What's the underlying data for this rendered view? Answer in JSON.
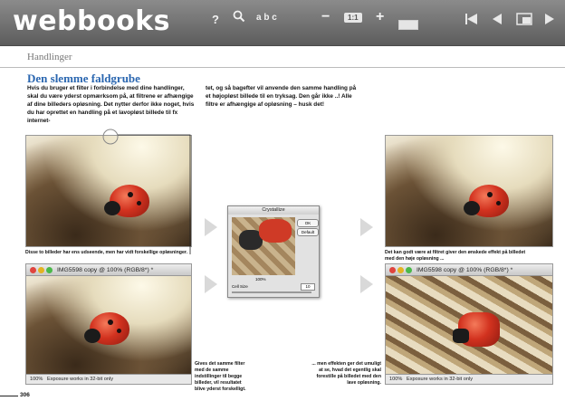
{
  "app": {
    "logo": "webbooks"
  },
  "toolbar": {
    "help_label": "?",
    "abc_label": "a b c",
    "zoom_minus_label": "−",
    "zoom_fit_label": "1:1",
    "zoom_plus_label": "+",
    "icons": [
      "search-icon",
      "fast-back-icon",
      "back-icon",
      "pages-icon",
      "forward-icon"
    ]
  },
  "page": {
    "section": "Handlinger",
    "title": "Den slemme faldgrube",
    "col1": "Hvis du bruger et filter i forbindelse med dine handlinger, skal du være yderst opmærksom på, at filtrene er afhængige af dine billeders opløsning. Det nytter derfor ikke noget, hvis du har oprettet en handling på et lavopløst billede til fx internet-",
    "col2": "tet, og så bagefter vil anvende den samme handling på et højopløst billede til en tryksag. Den går ikke ..! Alle filtre er afhængige af opløsning – husk det!",
    "caption_left": "Disse to billeder har ens udseende, men har vidt forskellige opløsninger.",
    "caption_right_top": "Det kan godt være at filtret giver den ønskede effekt på billedet med den høje opløsning ...",
    "caption_mid": "Gives det samme filter med de samme indstillinger til begge billeder, vil resultatet blive yderst forskelligt.",
    "caption_right_bottom": "... men effekten ger det umuligt at se, hvad det egentlig skal forestille på billedet med den lave opløsning.",
    "page_number": "306"
  },
  "windows": {
    "left_title": "IMG5598 copy @ 100% (RGB/8*) *",
    "right_title": "IMG5598 copy @ 100% (RGB/8*) *",
    "status_zoom": "100%",
    "status_text": "Exposure works in 32-bit only"
  },
  "dialog": {
    "title": "Crystallize",
    "ok_label": "OK",
    "default_label": "Default",
    "zoom_value": "100%",
    "field_label": "Cell Size",
    "field_value": "10"
  },
  "colors": {
    "toolbar_top": "#8b8b8b",
    "toolbar_bottom": "#5c5c5c",
    "title_blue": "#2a66b0",
    "ladybug_red": "#d2321f"
  }
}
